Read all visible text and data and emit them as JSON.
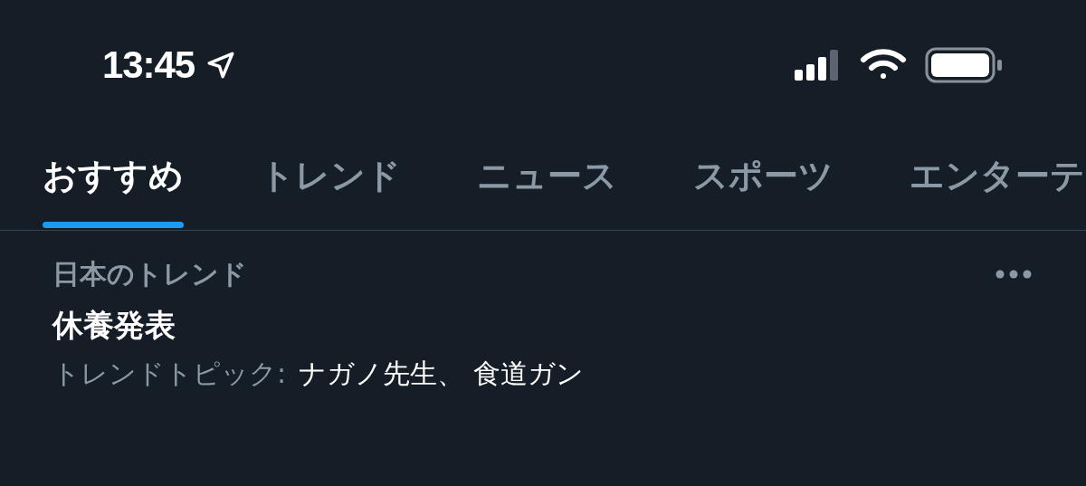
{
  "status_bar": {
    "time": "13:45",
    "location_on": true
  },
  "tabs": [
    {
      "label": "おすすめ",
      "selected": true
    },
    {
      "label": "トレンド",
      "selected": false
    },
    {
      "label": "ニュース",
      "selected": false
    },
    {
      "label": "スポーツ",
      "selected": false
    },
    {
      "label": "エンターテ",
      "selected": false
    }
  ],
  "trend": {
    "context": "日本のトレンド",
    "title": "休養発表",
    "topics_label": "トレンドトピック:",
    "topics": "ナガノ先生、 食道ガン"
  }
}
